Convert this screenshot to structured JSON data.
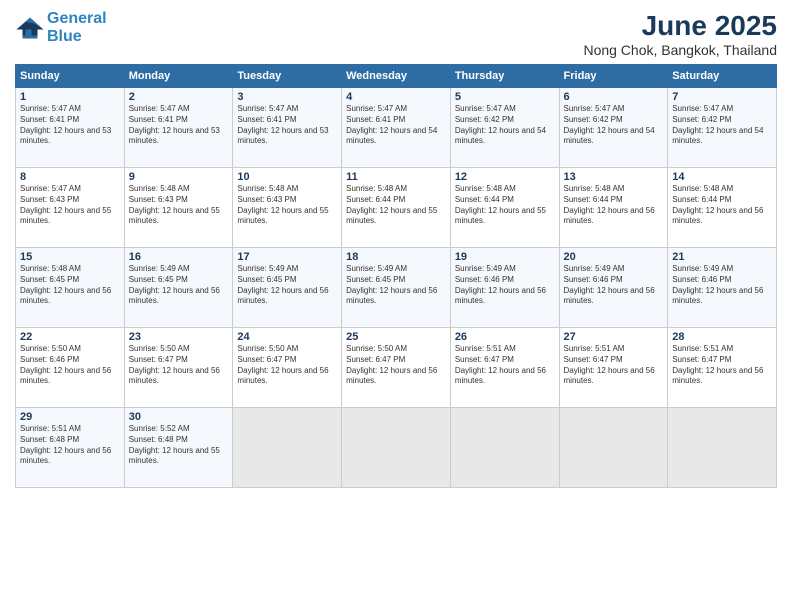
{
  "header": {
    "logo_line1": "General",
    "logo_line2": "Blue",
    "month": "June 2025",
    "location": "Nong Chok, Bangkok, Thailand"
  },
  "weekdays": [
    "Sunday",
    "Monday",
    "Tuesday",
    "Wednesday",
    "Thursday",
    "Friday",
    "Saturday"
  ],
  "weeks": [
    [
      {
        "day": "1",
        "sunrise": "5:47 AM",
        "sunset": "6:41 PM",
        "daylight": "12 hours and 53 minutes."
      },
      {
        "day": "2",
        "sunrise": "5:47 AM",
        "sunset": "6:41 PM",
        "daylight": "12 hours and 53 minutes."
      },
      {
        "day": "3",
        "sunrise": "5:47 AM",
        "sunset": "6:41 PM",
        "daylight": "12 hours and 53 minutes."
      },
      {
        "day": "4",
        "sunrise": "5:47 AM",
        "sunset": "6:41 PM",
        "daylight": "12 hours and 54 minutes."
      },
      {
        "day": "5",
        "sunrise": "5:47 AM",
        "sunset": "6:42 PM",
        "daylight": "12 hours and 54 minutes."
      },
      {
        "day": "6",
        "sunrise": "5:47 AM",
        "sunset": "6:42 PM",
        "daylight": "12 hours and 54 minutes."
      },
      {
        "day": "7",
        "sunrise": "5:47 AM",
        "sunset": "6:42 PM",
        "daylight": "12 hours and 54 minutes."
      }
    ],
    [
      {
        "day": "8",
        "sunrise": "5:47 AM",
        "sunset": "6:43 PM",
        "daylight": "12 hours and 55 minutes."
      },
      {
        "day": "9",
        "sunrise": "5:48 AM",
        "sunset": "6:43 PM",
        "daylight": "12 hours and 55 minutes."
      },
      {
        "day": "10",
        "sunrise": "5:48 AM",
        "sunset": "6:43 PM",
        "daylight": "12 hours and 55 minutes."
      },
      {
        "day": "11",
        "sunrise": "5:48 AM",
        "sunset": "6:44 PM",
        "daylight": "12 hours and 55 minutes."
      },
      {
        "day": "12",
        "sunrise": "5:48 AM",
        "sunset": "6:44 PM",
        "daylight": "12 hours and 55 minutes."
      },
      {
        "day": "13",
        "sunrise": "5:48 AM",
        "sunset": "6:44 PM",
        "daylight": "12 hours and 56 minutes."
      },
      {
        "day": "14",
        "sunrise": "5:48 AM",
        "sunset": "6:44 PM",
        "daylight": "12 hours and 56 minutes."
      }
    ],
    [
      {
        "day": "15",
        "sunrise": "5:48 AM",
        "sunset": "6:45 PM",
        "daylight": "12 hours and 56 minutes."
      },
      {
        "day": "16",
        "sunrise": "5:49 AM",
        "sunset": "6:45 PM",
        "daylight": "12 hours and 56 minutes."
      },
      {
        "day": "17",
        "sunrise": "5:49 AM",
        "sunset": "6:45 PM",
        "daylight": "12 hours and 56 minutes."
      },
      {
        "day": "18",
        "sunrise": "5:49 AM",
        "sunset": "6:45 PM",
        "daylight": "12 hours and 56 minutes."
      },
      {
        "day": "19",
        "sunrise": "5:49 AM",
        "sunset": "6:46 PM",
        "daylight": "12 hours and 56 minutes."
      },
      {
        "day": "20",
        "sunrise": "5:49 AM",
        "sunset": "6:46 PM",
        "daylight": "12 hours and 56 minutes."
      },
      {
        "day": "21",
        "sunrise": "5:49 AM",
        "sunset": "6:46 PM",
        "daylight": "12 hours and 56 minutes."
      }
    ],
    [
      {
        "day": "22",
        "sunrise": "5:50 AM",
        "sunset": "6:46 PM",
        "daylight": "12 hours and 56 minutes."
      },
      {
        "day": "23",
        "sunrise": "5:50 AM",
        "sunset": "6:47 PM",
        "daylight": "12 hours and 56 minutes."
      },
      {
        "day": "24",
        "sunrise": "5:50 AM",
        "sunset": "6:47 PM",
        "daylight": "12 hours and 56 minutes."
      },
      {
        "day": "25",
        "sunrise": "5:50 AM",
        "sunset": "6:47 PM",
        "daylight": "12 hours and 56 minutes."
      },
      {
        "day": "26",
        "sunrise": "5:51 AM",
        "sunset": "6:47 PM",
        "daylight": "12 hours and 56 minutes."
      },
      {
        "day": "27",
        "sunrise": "5:51 AM",
        "sunset": "6:47 PM",
        "daylight": "12 hours and 56 minutes."
      },
      {
        "day": "28",
        "sunrise": "5:51 AM",
        "sunset": "6:47 PM",
        "daylight": "12 hours and 56 minutes."
      }
    ],
    [
      {
        "day": "29",
        "sunrise": "5:51 AM",
        "sunset": "6:48 PM",
        "daylight": "12 hours and 56 minutes."
      },
      {
        "day": "30",
        "sunrise": "5:52 AM",
        "sunset": "6:48 PM",
        "daylight": "12 hours and 55 minutes."
      },
      null,
      null,
      null,
      null,
      null
    ]
  ]
}
